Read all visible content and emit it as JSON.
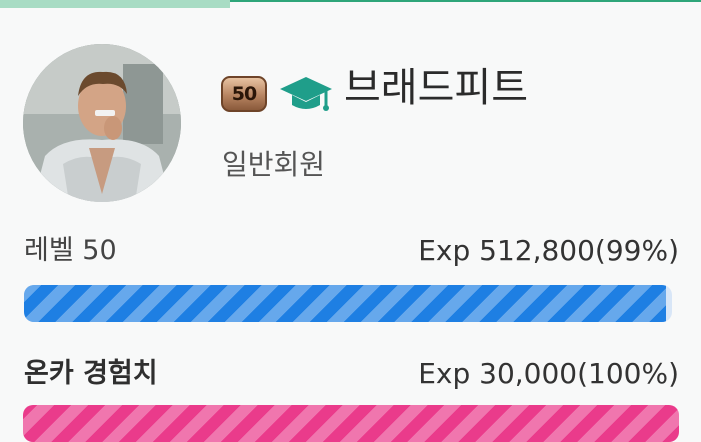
{
  "profile": {
    "level_badge": "50",
    "badge_icon": "graduation-cap-icon",
    "username": "브래드피트",
    "member_grade": "일반회원"
  },
  "level": {
    "label": "레벨 50",
    "value_text": "Exp 512,800(99%)",
    "progress_percent": 99,
    "color": "#1e7fe3"
  },
  "onca_exp": {
    "label": "온카 경험치",
    "value_text": "Exp 30,000(100%)",
    "progress_percent": 100,
    "color": "#ea3b8b"
  },
  "colors": {
    "accent_green": "#2ea67a",
    "badge_icon_color": "#1f9e8a"
  }
}
